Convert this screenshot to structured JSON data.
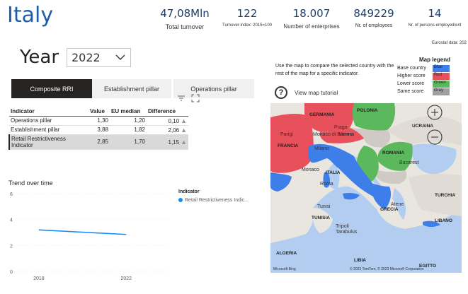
{
  "header": {
    "country": "Italy",
    "kpis": [
      {
        "value": "47,08Mln",
        "label": "Total turnover"
      },
      {
        "value": "122",
        "label": "Turnover index: 2015=100"
      },
      {
        "value": "18.007",
        "label": "Number of enterprises"
      },
      {
        "value": "849229",
        "label": "Nr. of employees"
      },
      {
        "value": "14",
        "label": "Nr. of persons employed/ent"
      }
    ],
    "source": "Eurostat data: 202"
  },
  "filters": {
    "year_label": "Year",
    "year_value": "2022"
  },
  "tabs": [
    {
      "label": "Composite RRI",
      "active": true
    },
    {
      "label": "Establishment pillar",
      "active": false
    },
    {
      "label": "Operations pillar",
      "active": false
    }
  ],
  "table": {
    "columns": [
      "Indicator",
      "Value",
      "EU median",
      "Difference"
    ],
    "rows": [
      {
        "indicator": "Operations pillar",
        "value": "1,30",
        "eu_median": "1,20",
        "difference": "0,10"
      },
      {
        "indicator": "Establishment pillar",
        "value": "3,88",
        "eu_median": "1,82",
        "difference": "2,06"
      },
      {
        "indicator": "Retail Restrictiveness Indicator",
        "value": "2,85",
        "eu_median": "1,70",
        "difference": "1,15"
      }
    ]
  },
  "trend": {
    "title": "Trend over time",
    "legend_title": "Indicator",
    "legend_item": "Retail Restrictiveness Indic...",
    "color": "#118dff"
  },
  "chart_data": {
    "type": "line",
    "x": [
      2018,
      2022
    ],
    "series": [
      {
        "name": "Retail Restrictiveness Indic...",
        "values": [
          3.2,
          2.85
        ]
      }
    ],
    "x_ticks": [
      "2018",
      "2022"
    ],
    "y_ticks": [
      "0",
      "2",
      "4",
      "6"
    ],
    "ylim": [
      0,
      6
    ],
    "xlim": [
      2017,
      2024
    ]
  },
  "map_panel": {
    "help_text": "Use the map to compare the selected country with the rest of the map for a specific indicator.",
    "tutorial": "View map tutorial",
    "legend_title": "Map legend",
    "legend": [
      {
        "label": "Base country",
        "swatch": "Blue",
        "color": "#3d7ee8"
      },
      {
        "label": "Higher score",
        "swatch": "Red",
        "color": "#e8505b"
      },
      {
        "label": "Lower score",
        "swatch": "Green",
        "color": "#5cb85c"
      },
      {
        "label": "Same score",
        "swatch": "Gray",
        "color": "#a0a0a0"
      }
    ],
    "places": {
      "germania": "GERMANIA",
      "polonia": "POLONIA",
      "praga": "Praga",
      "parigi": "Parigi",
      "ucraina": "UCRAINA",
      "monaco": "Monaco di Baviera",
      "vienna": "Vienna",
      "francia": "FRANCIA",
      "milano": "Milano",
      "romania": "ROMANIA",
      "bucarest": "Bucarest",
      "monaco2": "Monaco",
      "italia": "ITALIA",
      "roma": "Roma",
      "turchia": "TURCHIA",
      "grecia": "GRECIA",
      "atene": "Atene",
      "tunisia": "TUNISIA",
      "tunisi": "Tunisi",
      "libano": "LIBANO",
      "algeria": "ALGERIA",
      "tripoli": "Tripoli",
      "tarabulus": "Tarabulus",
      "libia": "LIBIA",
      "egitto": "EGITTO",
      "copyright": "© 2023 TomTom, © 2023 Microsoft Corporation",
      "bing": "Microsoft Bing"
    }
  }
}
